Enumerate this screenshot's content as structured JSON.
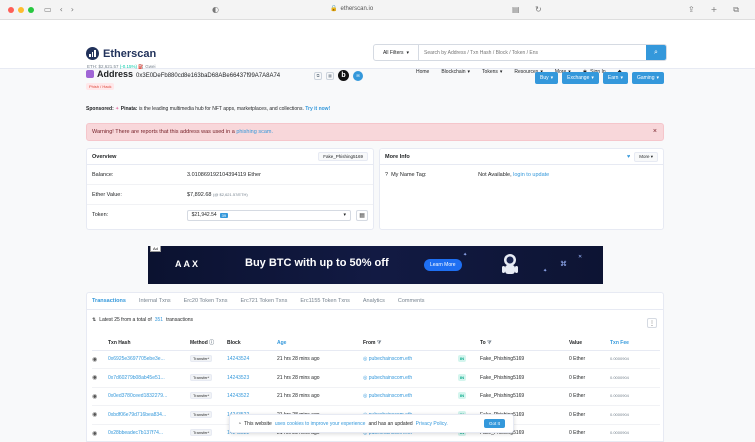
{
  "browser": {
    "url": "etherscan.io"
  },
  "header": {
    "logo_text": "Etherscan",
    "eth_price_label": "ETH: $2,621.57",
    "eth_change": "(-0.15%)",
    "gas": "Gwei",
    "search_filter": "All Filters",
    "search_placeholder": "Search by Address / Txn Hash / Block / Token / Ens",
    "nav": [
      "Home",
      "Blockchain",
      "Tokens",
      "Resources",
      "More",
      "Sign In"
    ]
  },
  "address": {
    "label": "Address",
    "value": "0x3E0DeFb880cd8e163baD68ABe66437f99A7A8A74",
    "tag": "Phish / Hack",
    "action_buttons": [
      "Buy",
      "Exchange",
      "Earn",
      "Gaming"
    ]
  },
  "sponsored": {
    "label": "Sponsored:",
    "brand": "Pinata",
    "text": "is the leading multimedia hub for NFT apps, marketplaces, and collections.",
    "cta": "Try it now!"
  },
  "warning": {
    "text": "Warning! There are reports that this address was used in a",
    "link": "phishing scam."
  },
  "overview": {
    "title": "Overview",
    "pill": "Fake_Phishing5169",
    "balance_label": "Balance:",
    "balance_value": "3.010869192104394119 Ether",
    "ether_value_label": "Ether Value:",
    "ether_value": "$7,892.68",
    "ether_value_note": "(@ $2,621.57/ETH)",
    "token_label": "Token:",
    "token_value": "$21,942.54",
    "token_count": "39"
  },
  "more_info": {
    "title": "More Info",
    "more_btn": "More",
    "name_tag_label": "My Name Tag:",
    "name_tag_value": "Not Available,",
    "name_tag_link": "login to update"
  },
  "banner": {
    "ad_tag": "Ad",
    "brand": "AAX",
    "headline": "Buy BTC with up to 50% off",
    "cta": "Learn More"
  },
  "tabs": [
    "Transactions",
    "Internal Txns",
    "Erc20 Token Txns",
    "Erc721 Token Txns",
    "Erc1155 Token Txns",
    "Analytics",
    "Comments"
  ],
  "tx_summary": {
    "prefix": "Latest 25 from a total of",
    "total": "351",
    "suffix": "transactions"
  },
  "table": {
    "headers": [
      "Txn Hash",
      "Method",
      "Block",
      "Age",
      "From",
      "",
      "To",
      "Value",
      "Txn Fee"
    ],
    "rows": [
      {
        "hash": "0x6925e3697705ebe3e...",
        "method": "Transfer*",
        "block": "14243524",
        "age": "21 hrs 28 mins ago",
        "from": "pubechainscom.eth",
        "dir": "IN",
        "to": "Fake_Phishing5169",
        "value": "0 Ether",
        "fee": "0.0000904"
      },
      {
        "hash": "0x7d60279b08ab45e51...",
        "method": "Transfer*",
        "block": "14243523",
        "age": "21 hrs 28 mins ago",
        "from": "pubechainscom.eth",
        "dir": "IN",
        "to": "Fake_Phishing5169",
        "value": "0 Ether",
        "fee": "0.0000904"
      },
      {
        "hash": "0x0ed3780ceed1832279...",
        "method": "Transfer*",
        "block": "14243522",
        "age": "21 hrs 28 mins ago",
        "from": "pubechainscom.eth",
        "dir": "IN",
        "to": "Fake_Phishing5169",
        "value": "0 Ether",
        "fee": "0.0000904"
      },
      {
        "hash": "0xbdf06e79d716bea834...",
        "method": "Transfer*",
        "block": "14243522",
        "age": "21 hrs 28 mins ago",
        "from": "pubechainscom.eth",
        "dir": "IN",
        "to": "Fake_Phishing5169",
        "value": "0 Ether",
        "fee": "0.0000904"
      },
      {
        "hash": "0x28bbeadec7b137f74...",
        "method": "Transfer*",
        "block": "14243522",
        "age": "21 hrs 28 mins ago",
        "from": "pubechainscom.eth",
        "dir": "IN",
        "to": "Fake_Phishing5169",
        "value": "0 Ether",
        "fee": "0.0000904"
      }
    ]
  },
  "cookie": {
    "text1": "This website",
    "link1": "uses cookies to improve your experience",
    "text2": "and has an updated",
    "link2": "Privacy Policy.",
    "button": "Got It"
  },
  "colors": {
    "accent": "#3498db",
    "danger_bg": "#f8d7da",
    "brand_navy": "#21325b"
  }
}
